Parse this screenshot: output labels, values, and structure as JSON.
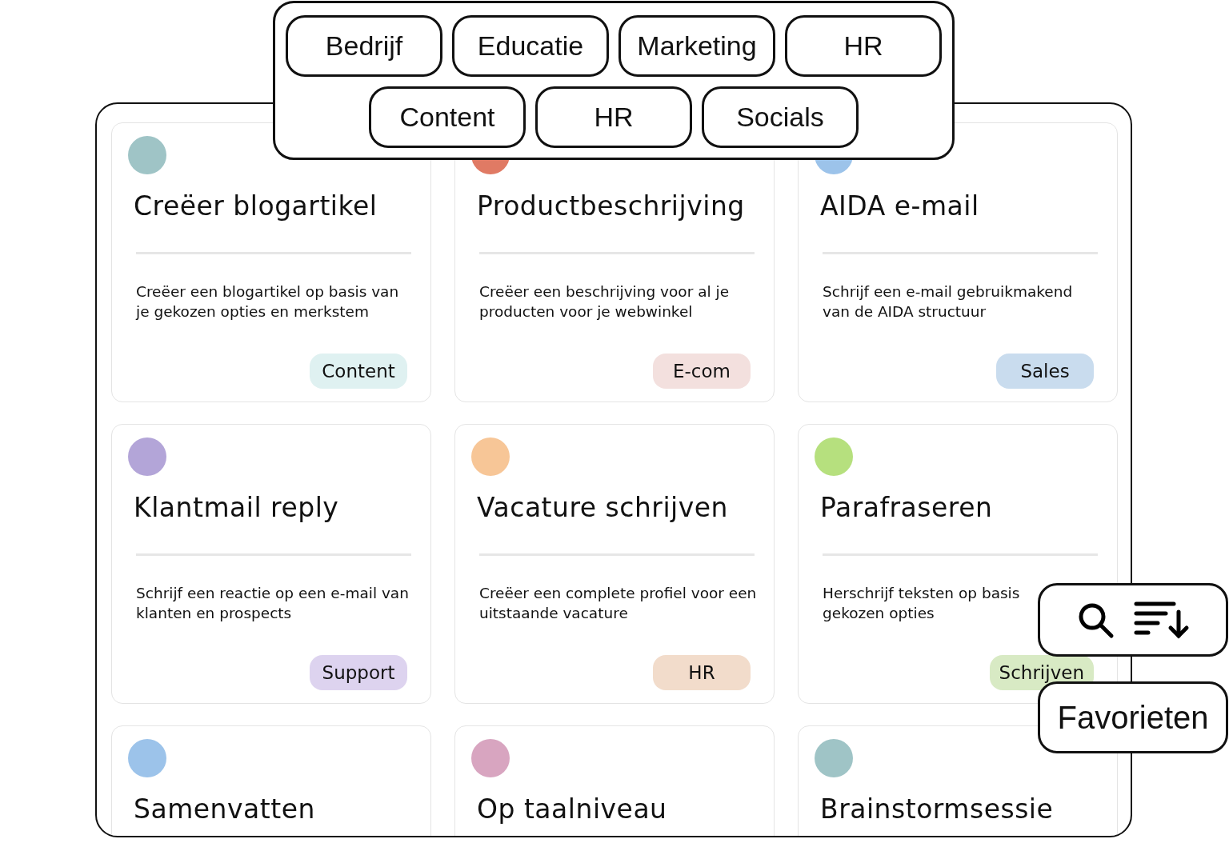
{
  "filters": [
    {
      "label": "Bedrijf"
    },
    {
      "label": "Educatie"
    },
    {
      "label": "Marketing"
    },
    {
      "label": "HR"
    },
    {
      "label": "Content"
    },
    {
      "label": "HR"
    },
    {
      "label": "Socials"
    }
  ],
  "cards": [
    {
      "title": "Creëer blogartikel",
      "description": "Creëer een blogartikel op basis van je gekozen opties en merkstem",
      "tag": {
        "label": "Content",
        "color": "#dff1f1"
      },
      "color": "#9fc4c6"
    },
    {
      "title": "Productbeschrijving",
      "description": "Creëer een beschrijving voor al je producten voor je webwinkel",
      "tag": {
        "label": "E-com",
        "color": "#f3e0de"
      },
      "color": "#e07a64"
    },
    {
      "title": "AIDA e-mail",
      "description": "Schrijf een e-mail gebruikmakend van de AIDA structuur",
      "tag": {
        "label": "Sales",
        "color": "#c9dcee"
      },
      "color": "#9cc3ea"
    },
    {
      "title": "Klantmail reply",
      "description": "Schrijf een reactie op een e-mail van klanten en prospects",
      "tag": {
        "label": "Support",
        "color": "#ddd3ef"
      },
      "color": "#b3a5d8"
    },
    {
      "title": "Vacature schrijven",
      "description": "Creëer een complete profiel voor een uitstaande vacature",
      "tag": {
        "label": "HR",
        "color": "#f2dccb"
      },
      "color": "#f7c697"
    },
    {
      "title": "Parafraseren",
      "description": "Herschrijf teksten op basis\ngekozen opties",
      "tag": {
        "label": "Schrijven",
        "color": "#d8eac4"
      },
      "color": "#b6e07e"
    },
    {
      "title": "Samenvatten",
      "color": "#9cc3ea"
    },
    {
      "title": "Op taalniveau",
      "color": "#d8a5c0"
    },
    {
      "title": "Brainstormsessie",
      "color": "#9fc4c6"
    }
  ],
  "favorites_button": {
    "label": "Favorieten"
  }
}
